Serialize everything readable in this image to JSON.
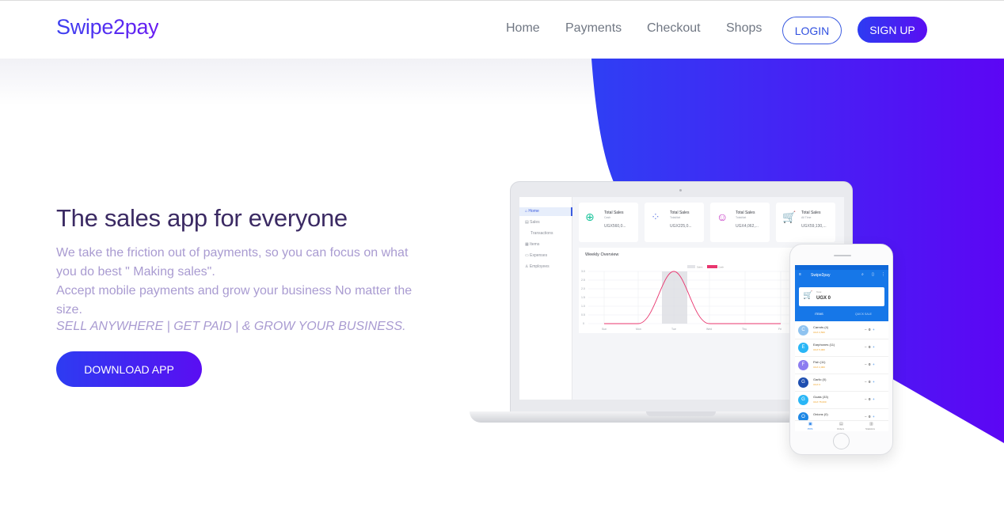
{
  "brand": {
    "logo": "Swipe2pay"
  },
  "nav": {
    "links": [
      "Home",
      "Payments",
      "Checkout",
      "Shops"
    ],
    "login": "LOGIN",
    "signup": "SIGN UP"
  },
  "hero": {
    "title": "The sales app for everyone",
    "desc1": "We take the friction out of payments, so you can focus on what you do best \" Making sales\".",
    "desc2": "Accept mobile payments and grow your business No matter the size.",
    "tagline": "SELL ANYWHERE | GET PAID | & GROW YOUR BUSINESS.",
    "cta": "DOWNLOAD APP"
  },
  "colors": {
    "accent_start": "#2d3cf2",
    "accent_end": "#5a0ef2",
    "title": "#3b2a63",
    "body": "#a99bd1"
  },
  "dashboard": {
    "sidebar": [
      "Home",
      "Sales",
      "Transactions",
      "Items",
      "Expenses",
      "Employees"
    ],
    "cards": [
      {
        "icon": "yen-icon",
        "title": "Total Sales",
        "sub": "Cash",
        "value": "UGX560,0..."
      },
      {
        "icon": "apps-icon",
        "title": "Total Sales",
        "sub": "Total/dat",
        "value": "UGX225,0..."
      },
      {
        "icon": "chat-icon",
        "title": "Total Sales",
        "sub": "Total/dat",
        "value": "UGX4,062,..."
      },
      {
        "icon": "cart-icon",
        "title": "Total Sales",
        "sub": "All Time",
        "value": "UGX59,130,..."
      }
    ],
    "chart_title": "Weekly Overview",
    "chart_legend": [
      "Sales",
      "Cash"
    ],
    "chart_ticks_y": [
      "3.0",
      "2.5",
      "2.0",
      "1.5",
      "1.0",
      "0.5",
      "0"
    ],
    "chart_ticks_x": [
      "Sun",
      "Mon",
      "Tue",
      "Wed",
      "Thu",
      "Fri"
    ]
  },
  "phone": {
    "app_title": "Swipe2pay",
    "total_label": "Total",
    "total": "UGX 0",
    "tabs": [
      "ITEMS",
      "QUICK SALE"
    ],
    "items": [
      {
        "letter": "C",
        "name": "Carrots (4)",
        "price": "UGX 2,500",
        "qty": "0",
        "color": "#8fc3f0"
      },
      {
        "letter": "E",
        "name": "Earphones (11)",
        "price": "UGX 5,000",
        "qty": "0",
        "color": "#29b6f6"
      },
      {
        "letter": "F",
        "name": "Fish (11)",
        "price": "UGX 2,000",
        "qty": "0",
        "color": "#8c7cf0"
      },
      {
        "letter": "G",
        "name": "Garlic (0)",
        "price": "UGX 0",
        "qty": "0",
        "color": "#1e4fb0"
      },
      {
        "letter": "G",
        "name": "Goats (33)",
        "price": "UGX 75,000",
        "qty": "0",
        "color": "#29b6f6"
      },
      {
        "letter": "O",
        "name": "Onions (0)",
        "price": "",
        "qty": "0",
        "color": "#1e88e5"
      }
    ],
    "bottom_nav": [
      "POS",
      "Orders",
      "Statistics"
    ]
  }
}
